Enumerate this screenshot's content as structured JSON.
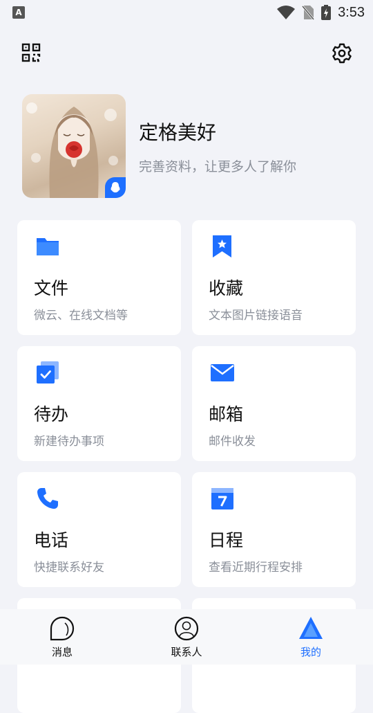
{
  "status_bar": {
    "time": "3:53",
    "left_icon": "A"
  },
  "header": {
    "qr_icon": "qr-code-icon",
    "settings_icon": "gear-icon"
  },
  "profile": {
    "nickname": "定格美好",
    "subtitle": "完善资料，让更多人了解你"
  },
  "cards": [
    {
      "title": "文件",
      "subtitle": "微云、在线文档等",
      "icon": "folder-icon"
    },
    {
      "title": "收藏",
      "subtitle": "文本图片链接语音",
      "icon": "bookmark-star-icon"
    },
    {
      "title": "待办",
      "subtitle": "新建待办事项",
      "icon": "todo-check-icon"
    },
    {
      "title": "邮箱",
      "subtitle": "邮件收发",
      "icon": "mail-icon"
    },
    {
      "title": "电话",
      "subtitle": "快捷联系好友",
      "icon": "phone-icon"
    },
    {
      "title": "日程",
      "subtitle": "查看近期行程安排",
      "icon": "calendar-icon"
    }
  ],
  "bottom_nav": [
    {
      "label": "消息",
      "icon": "message-icon",
      "active": false
    },
    {
      "label": "联系人",
      "icon": "contacts-icon",
      "active": false
    },
    {
      "label": "我的",
      "icon": "me-icon",
      "active": true
    }
  ],
  "colors": {
    "accent": "#1E6FFF",
    "background": "#F2F3F8",
    "muted_text": "#8A8F99"
  }
}
